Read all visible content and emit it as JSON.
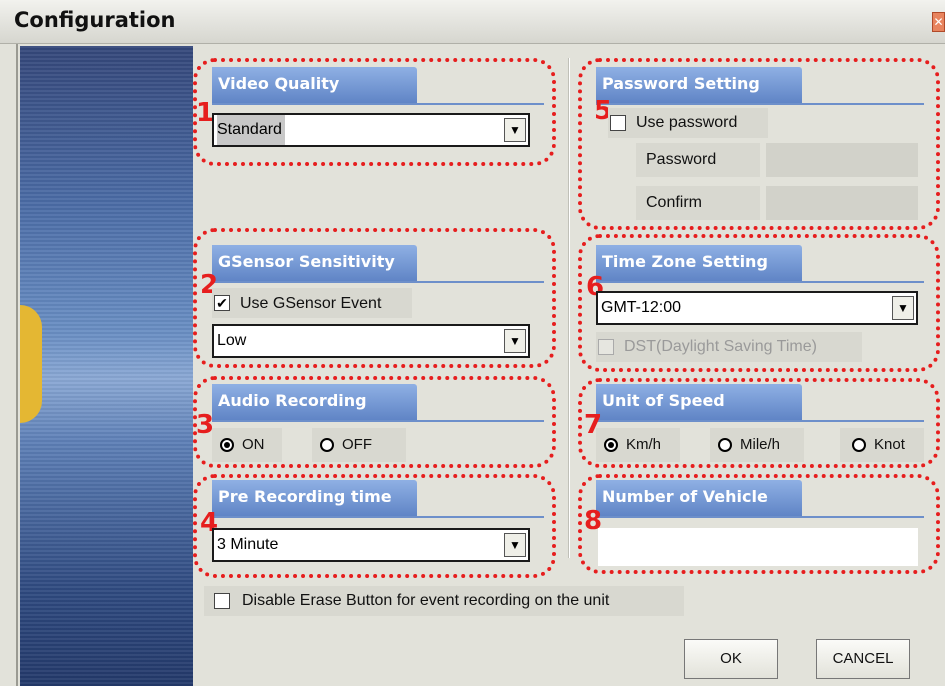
{
  "window": {
    "title": "Configuration",
    "close_icon": "close-icon"
  },
  "groups": {
    "video_quality": {
      "num": "1",
      "title": "Video Quality",
      "value": "Standard"
    },
    "gsensor": {
      "num": "2",
      "title": "GSensor Sensitivity",
      "checkbox_label": "Use GSensor Event",
      "checked": true,
      "value": "Low"
    },
    "audio": {
      "num": "3",
      "title": "Audio Recording",
      "options": [
        "ON",
        "OFF"
      ],
      "selected": "ON"
    },
    "pre_recording": {
      "num": "4",
      "title": "Pre Recording time",
      "value": "3 Minute"
    },
    "password": {
      "num": "5",
      "title": "Password Setting",
      "checkbox_label": "Use password",
      "checked": false,
      "password_label": "Password",
      "confirm_label": "Confirm"
    },
    "timezone": {
      "num": "6",
      "title": "Time Zone Setting",
      "value": "GMT-12:00",
      "dst_label": "DST(Daylight Saving Time)",
      "dst_checked": false
    },
    "speed": {
      "num": "7",
      "title": "Unit of Speed",
      "options": [
        "Km/h",
        "Mile/h",
        "Knot"
      ],
      "selected": "Km/h"
    },
    "vehicle": {
      "num": "8",
      "title": "Number of Vehicle",
      "value": ""
    }
  },
  "disable_erase": {
    "label": "Disable Erase Button for event recording on the unit",
    "checked": false
  },
  "buttons": {
    "ok": "OK",
    "cancel": "CANCEL"
  },
  "colors": {
    "highlight": "#e61e1e",
    "tab": "#6d8fca"
  }
}
